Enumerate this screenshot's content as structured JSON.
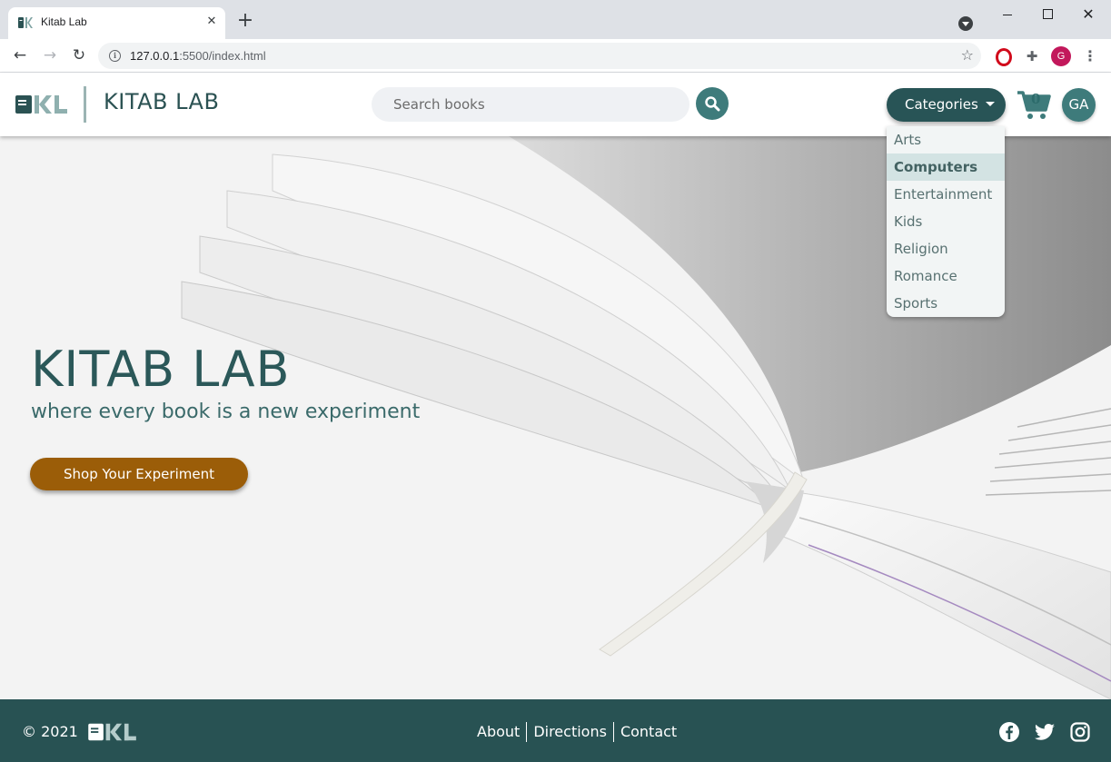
{
  "browser": {
    "tab_title": "Kitab Lab",
    "new_tab": "+",
    "url_host": "127.0.0.1",
    "url_rest": ":5500/index.html",
    "profile_initial": "G"
  },
  "header": {
    "brand": "KITAB LAB",
    "logo_text": "KL",
    "search_placeholder": "Search books",
    "categories_label": "Categories",
    "cart_count": "0",
    "avatar_initials": "GA"
  },
  "categories": {
    "items": [
      "Arts",
      "Computers",
      "Entertainment",
      "Kids",
      "Religion",
      "Romance",
      "Sports"
    ],
    "highlighted": "Computers"
  },
  "hero": {
    "title": "KITAB LAB",
    "subtitle": "where every book is a new experiment",
    "cta_label": "Shop Your Experiment"
  },
  "footer": {
    "copyright": "© 2021",
    "links": [
      "About",
      "Directions",
      "Contact"
    ],
    "social": [
      "facebook-icon",
      "twitter-icon",
      "instagram-icon"
    ]
  },
  "colors": {
    "primary_dark": "#285456",
    "primary": "#3e7b7b",
    "accent": "#9b5d08",
    "footer_bg": "#285253"
  }
}
